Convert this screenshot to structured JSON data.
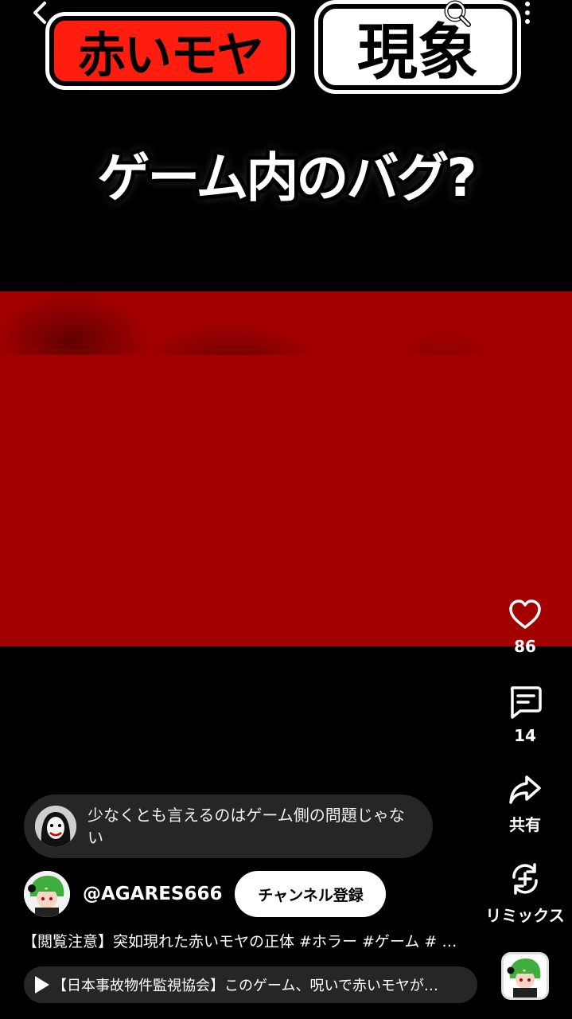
{
  "overlay": {
    "title_red": "赤いモヤ",
    "title_white": "現象",
    "subtitle": "ゲーム内のバグ?"
  },
  "actions": {
    "like_count": "86",
    "comment_count": "14",
    "share_label": "共有",
    "remix_label": "リミックス"
  },
  "comment": {
    "text": "少なくとも言えるのはゲーム側の問題じゃない"
  },
  "channel": {
    "handle": "@AGARES666",
    "subscribe_label": "チャンネル登録"
  },
  "description": "【閲覧注意】突如現れた赤いモヤの正体 #ホラー #ゲーム # …",
  "related_video": "【日本事故物件監視協会】このゲーム、呪いで赤いモヤが…",
  "icons": {
    "back": "chevron-left-icon",
    "search": "search-icon",
    "more": "more-vertical-icon",
    "like": "heart-icon",
    "comment": "comment-icon",
    "share": "share-icon",
    "remix": "remix-icon",
    "play": "play-icon"
  },
  "colors": {
    "title_red": "#ff1d10",
    "video_red": "#a30000",
    "bubble_bg": "#262626"
  }
}
